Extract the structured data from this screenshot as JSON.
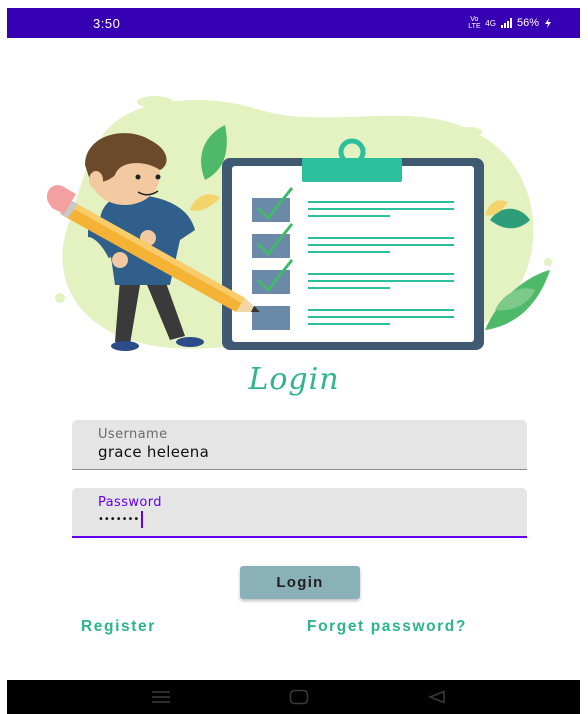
{
  "status_bar": {
    "time": "3:50",
    "volte": "Vo LTE",
    "network": "4G",
    "battery": "56%",
    "icons": [
      "volte-icon",
      "signal-icon",
      "charging-icon"
    ]
  },
  "illustration": {
    "name": "person-with-pencil-checklist-illustration"
  },
  "title": "Login",
  "form": {
    "username": {
      "label": "Username",
      "value": "grace heleena"
    },
    "password": {
      "label": "Password",
      "value": "•••••••"
    }
  },
  "login_button": "Login",
  "links": {
    "register": "Register",
    "forgot": "Forget password?"
  },
  "nav_bar": {
    "icons": [
      "menu-icon",
      "home-icon",
      "back-icon"
    ]
  },
  "colors": {
    "status_bar": "#3700b3",
    "accent": "#6200ee",
    "brand_green": "#2cb58b",
    "button": "#8ab0b8"
  }
}
